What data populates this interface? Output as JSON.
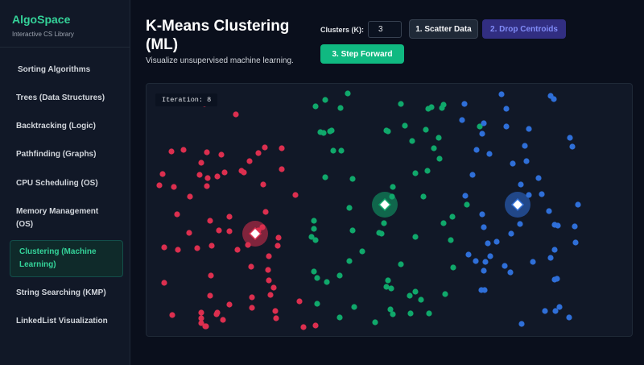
{
  "brand": {
    "name": "AlgoSpace",
    "subtitle": "Interactive CS Library"
  },
  "nav": [
    "Sorting Algorithms",
    "Trees (Data Structures)",
    "Backtracking (Logic)",
    "Pathfinding (Graphs)",
    "CPU Scheduling (OS)",
    "Memory Management (OS)",
    "Clustering (Machine Learning)",
    "String Searching (KMP)",
    "LinkedList Visualization"
  ],
  "active_nav": "Clustering (Machine Learning)",
  "header": {
    "title": "K-Means Clustering (ML)",
    "subtitle": "Visualize unsupervised machine learning."
  },
  "controls": {
    "clusters_label": "Clusters (K):",
    "clusters_value": "3",
    "scatter_label": "1. Scatter Data",
    "drop_label": "2. Drop Centroids",
    "step_label": "3. Step Forward"
  },
  "status": {
    "iteration_text": "Iteration: 8"
  },
  "colors": {
    "cluster_red": "#dc2f4f",
    "cluster_green": "#10a86b",
    "cluster_blue": "#2f6fd8"
  },
  "chart_data": {
    "type": "scatter",
    "clusters": [
      {
        "color": "#dc2f4f",
        "centroid": [
          135,
          186
        ],
        "points": [
          [
            72,
            25
          ],
          [
            111,
            38
          ],
          [
            46,
            82
          ],
          [
            31,
            84
          ],
          [
            75,
            85
          ],
          [
            93,
            88
          ],
          [
            147,
            79
          ],
          [
            139,
            86
          ],
          [
            168,
            80
          ],
          [
            128,
            96
          ],
          [
            68,
            98
          ],
          [
            118,
            108
          ],
          [
            97,
            110
          ],
          [
            121,
            110
          ],
          [
            168,
            106
          ],
          [
            66,
            113
          ],
          [
            88,
            115
          ],
          [
            145,
            125
          ],
          [
            76,
            117
          ],
          [
            20,
            112
          ],
          [
            16,
            126
          ],
          [
            34,
            128
          ],
          [
            75,
            127
          ],
          [
            185,
            138
          ],
          [
            54,
            140
          ],
          [
            38,
            162
          ],
          [
            148,
            159
          ],
          [
            103,
            165
          ],
          [
            79,
            170
          ],
          [
            144,
            178
          ],
          [
            90,
            182
          ],
          [
            53,
            185
          ],
          [
            103,
            183
          ],
          [
            139,
            182
          ],
          [
            164,
            191
          ],
          [
            81,
            201
          ],
          [
            126,
            200
          ],
          [
            22,
            203
          ],
          [
            39,
            206
          ],
          [
            63,
            204
          ],
          [
            113,
            206
          ],
          [
            163,
            201
          ],
          [
            152,
            214
          ],
          [
            130,
            227
          ],
          [
            80,
            238
          ],
          [
            151,
            231
          ],
          [
            152,
            244
          ],
          [
            158,
            253
          ],
          [
            79,
            263
          ],
          [
            22,
            247
          ],
          [
            154,
            262
          ],
          [
            131,
            265
          ],
          [
            190,
            270
          ],
          [
            103,
            274
          ],
          [
            131,
            278
          ],
          [
            160,
            282
          ],
          [
            68,
            284
          ],
          [
            88,
            284
          ],
          [
            161,
            291
          ],
          [
            32,
            287
          ],
          [
            87,
            286
          ],
          [
            68,
            291
          ],
          [
            95,
            293
          ],
          [
            68,
            297
          ],
          [
            195,
            302
          ],
          [
            210,
            300
          ],
          [
            73,
            301
          ],
          [
            74,
            301
          ]
        ]
      },
      {
        "color": "#10a86b",
        "centroid": [
          296,
          150
        ],
        "points": [
          [
            210,
            28
          ],
          [
            222,
            20
          ],
          [
            250,
            12
          ],
          [
            241,
            30
          ],
          [
            316,
            25
          ],
          [
            354,
            29
          ],
          [
            350,
            31
          ],
          [
            369,
            26
          ],
          [
            367,
            30
          ],
          [
            220,
            61
          ],
          [
            216,
            60
          ],
          [
            230,
            58
          ],
          [
            228,
            59
          ],
          [
            300,
            59
          ],
          [
            298,
            58
          ],
          [
            321,
            52
          ],
          [
            347,
            57
          ],
          [
            414,
            53
          ],
          [
            232,
            83
          ],
          [
            242,
            83
          ],
          [
            330,
            71
          ],
          [
            363,
            67
          ],
          [
            357,
            80
          ],
          [
            222,
            116
          ],
          [
            256,
            118
          ],
          [
            306,
            128
          ],
          [
            334,
            111
          ],
          [
            349,
            108
          ],
          [
            364,
            93
          ],
          [
            305,
            140
          ],
          [
            344,
            140
          ],
          [
            252,
            154
          ],
          [
            208,
            170
          ],
          [
            295,
            173
          ],
          [
            289,
            185
          ],
          [
            292,
            186
          ],
          [
            334,
            190
          ],
          [
            208,
            180
          ],
          [
            205,
            190
          ],
          [
            210,
            194
          ],
          [
            380,
            165
          ],
          [
            256,
            182
          ],
          [
            369,
            173
          ],
          [
            398,
            150
          ],
          [
            378,
            194
          ],
          [
            252,
            220
          ],
          [
            208,
            233
          ],
          [
            212,
            241
          ],
          [
            240,
            238
          ],
          [
            224,
            246
          ],
          [
            300,
            244
          ],
          [
            316,
            224
          ],
          [
            268,
            208
          ],
          [
            304,
            254
          ],
          [
            298,
            252
          ],
          [
            341,
            268
          ],
          [
            334,
            258
          ],
          [
            327,
            263
          ],
          [
            371,
            261
          ],
          [
            212,
            273
          ],
          [
            258,
            277
          ],
          [
            240,
            290
          ],
          [
            284,
            296
          ],
          [
            303,
            280
          ],
          [
            306,
            286
          ],
          [
            328,
            285
          ],
          [
            351,
            285
          ],
          [
            381,
            228
          ]
        ]
      },
      {
        "color": "#2f6fd8",
        "centroid": [
          461,
          150
        ],
        "points": [
          [
            395,
            25
          ],
          [
            441,
            13
          ],
          [
            447,
            31
          ],
          [
            502,
            15
          ],
          [
            506,
            19
          ],
          [
            392,
            45
          ],
          [
            419,
            49
          ],
          [
            447,
            53
          ],
          [
            475,
            56
          ],
          [
            417,
            62
          ],
          [
            529,
            78
          ],
          [
            526,
            67
          ],
          [
            410,
            82
          ],
          [
            470,
            77
          ],
          [
            426,
            87
          ],
          [
            472,
            96
          ],
          [
            455,
            99
          ],
          [
            405,
            113
          ],
          [
            465,
            125
          ],
          [
            487,
            117
          ],
          [
            475,
            138
          ],
          [
            396,
            139
          ],
          [
            491,
            137
          ],
          [
            417,
            162
          ],
          [
            500,
            158
          ],
          [
            536,
            150
          ],
          [
            532,
            177
          ],
          [
            419,
            178
          ],
          [
            464,
            174
          ],
          [
            453,
            186
          ],
          [
            511,
            176
          ],
          [
            507,
            175
          ],
          [
            424,
            198
          ],
          [
            435,
            196
          ],
          [
            533,
            197
          ],
          [
            400,
            212
          ],
          [
            427,
            214
          ],
          [
            409,
            220
          ],
          [
            421,
            221
          ],
          [
            445,
            226
          ],
          [
            502,
            216
          ],
          [
            507,
            206
          ],
          [
            480,
            221
          ],
          [
            419,
            232
          ],
          [
            452,
            234
          ],
          [
            507,
            243
          ],
          [
            510,
            242
          ],
          [
            416,
            256
          ],
          [
            420,
            256
          ],
          [
            495,
            282
          ],
          [
            508,
            282
          ],
          [
            525,
            290
          ],
          [
            466,
            298
          ],
          [
            513,
            277
          ]
        ]
      }
    ]
  }
}
